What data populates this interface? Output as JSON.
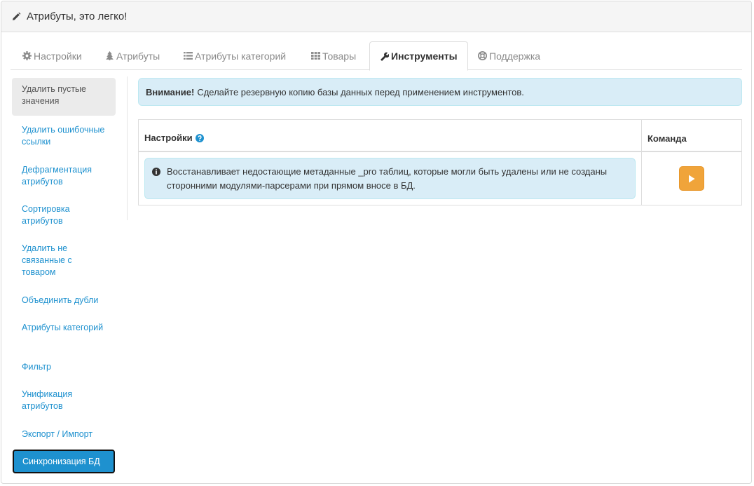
{
  "header": {
    "title": "Атрибуты, это легко!",
    "icon": "pencil-icon"
  },
  "tabs": [
    {
      "label": "Настройки",
      "icon": "gear-icon"
    },
    {
      "label": "Атрибуты",
      "icon": "tree-icon"
    },
    {
      "label": "Атрибуты категорий",
      "icon": "list-icon"
    },
    {
      "label": "Товары",
      "icon": "grid-icon"
    },
    {
      "label": "Инструменты",
      "icon": "wrench-icon",
      "active": true
    },
    {
      "label": "Поддержка",
      "icon": "lifebuoy-icon"
    }
  ],
  "sidebar": {
    "items": [
      {
        "label": "Удалить пустые значения",
        "state": "selected"
      },
      {
        "label": "Удалить ошибочные ссылки"
      },
      {
        "label": "Дефрагментация атрибутов"
      },
      {
        "label": "Сортировка атрибутов"
      },
      {
        "label": "Удалить не связанные с товаром"
      },
      {
        "label": "Объединить дубли"
      },
      {
        "label": "Атрибуты категорий"
      },
      {
        "label": "Фильтр"
      },
      {
        "label": "Унификация атрибутов"
      },
      {
        "label": "Экспорт / Импорт"
      },
      {
        "label": "Синхронизация БД",
        "state": "focused"
      }
    ]
  },
  "alert": {
    "strong": "Внимание!",
    "text": "Сделайте резервную копию базы данных перед применением инструментов."
  },
  "table": {
    "col_settings": "Настройки",
    "col_command": "Команда",
    "row_info": "Восстанавливает недостающие метаданные _pro таблиц, которые могли быть удалены или не созданы сторонними модулями-парсерами при прямом вносе в БД.",
    "play_button_icon": "play-icon"
  },
  "colors": {
    "link": "#1e91cf",
    "info_bg": "#d9edf7",
    "button_orange": "#f0a43a"
  }
}
